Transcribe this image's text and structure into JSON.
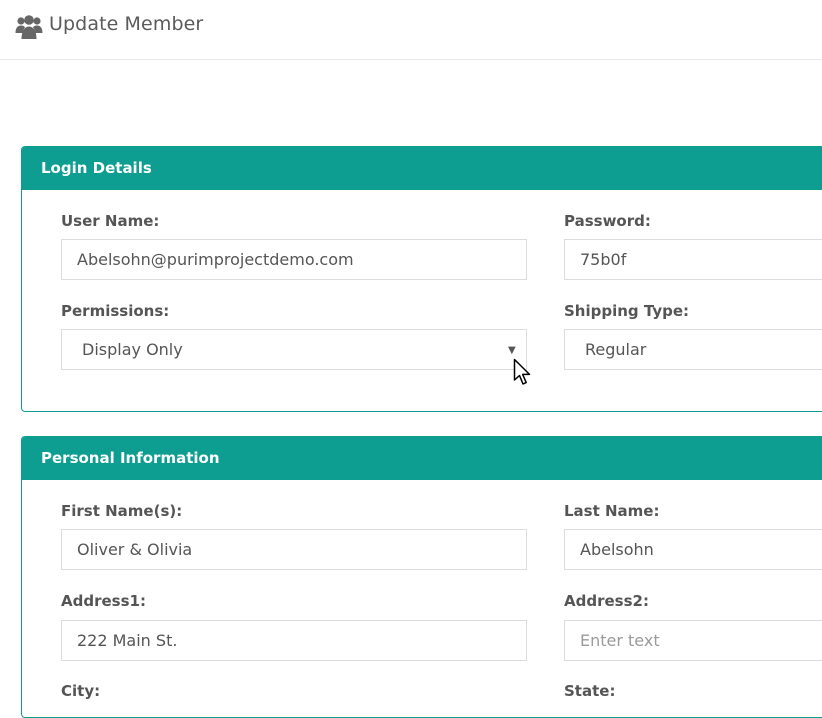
{
  "header": {
    "title": "Update Member",
    "icon": "users-icon"
  },
  "colors": {
    "accent": "#0e9e91",
    "border": "#dcdcdc",
    "text": "#555555"
  },
  "login_details": {
    "title": "Login Details",
    "username": {
      "label": "User Name:",
      "value": "Abelsohn@purimprojectdemo.com"
    },
    "password": {
      "label": "Password:",
      "value": "75b0f"
    },
    "permissions": {
      "label": "Permissions:",
      "value": "Display Only"
    },
    "shipping_type": {
      "label": "Shipping Type:",
      "value": "Regular"
    }
  },
  "personal_information": {
    "title": "Personal Information",
    "first_name": {
      "label": "First Name(s):",
      "value": "Oliver & Olivia"
    },
    "last_name": {
      "label": "Last Name:",
      "value": "Abelsohn"
    },
    "address1": {
      "label": "Address1:",
      "value": "222 Main St."
    },
    "address2": {
      "label": "Address2:",
      "value": "",
      "placeholder": "Enter text"
    },
    "city": {
      "label": "City:"
    },
    "state": {
      "label": "State:"
    }
  }
}
